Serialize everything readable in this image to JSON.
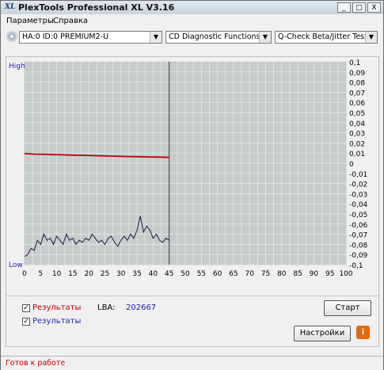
{
  "window": {
    "app_icon_text": "XL",
    "title": "PlexTools Professional XL V3.16",
    "minimize": "_",
    "maximize": "□",
    "close": "X"
  },
  "menu": {
    "items": [
      "Параметры",
      "Справка"
    ]
  },
  "toolbar": {
    "drive": "HA:0 ID:0  PREMIUM2-U",
    "function": "CD Diagnostic Functions",
    "test": "Q-Check Beta/Jitter Test"
  },
  "chart_data": {
    "type": "line",
    "left_axis_labels": {
      "top": "High",
      "bottom": "Low"
    },
    "right_axis": {
      "ticks": [
        "0,1",
        "0,09",
        "0,08",
        "0,07",
        "0,06",
        "0,05",
        "0,04",
        "0,03",
        "0,02",
        "0,01",
        "0",
        "-0,01",
        "-0,02",
        "-0,03",
        "-0,04",
        "-0,05",
        "-0,06",
        "-0,07",
        "-0,08",
        "-0,09",
        "-0,1"
      ],
      "ylim": [
        -0.1,
        0.1
      ]
    },
    "x_ticks": [
      "0",
      "5",
      "10",
      "15",
      "20",
      "25",
      "30",
      "35",
      "40",
      "45",
      "50",
      "55",
      "60",
      "65",
      "70",
      "75",
      "80",
      "85",
      "90",
      "95",
      "100"
    ],
    "xlim": [
      0,
      100
    ],
    "grid": true,
    "progress_x": 45,
    "series": [
      {
        "color": "#c00000",
        "axis": "right",
        "x": [
          0,
          3,
          6,
          9,
          12,
          15,
          18,
          21,
          24,
          27,
          30,
          33,
          36,
          39,
          42,
          45
        ],
        "y": [
          0.0095,
          0.009,
          0.0088,
          0.0085,
          0.0083,
          0.008,
          0.0078,
          0.0075,
          0.0073,
          0.007,
          0.0068,
          0.0066,
          0.0064,
          0.0062,
          0.006,
          0.0058
        ]
      },
      {
        "color": "#1a1a40",
        "axis": "left-relative",
        "x": [
          0,
          1,
          2,
          3,
          4,
          5,
          6,
          7,
          8,
          9,
          10,
          11,
          12,
          13,
          14,
          15,
          16,
          17,
          18,
          19,
          20,
          21,
          22,
          23,
          24,
          25,
          26,
          27,
          28,
          29,
          30,
          31,
          32,
          33,
          34,
          35,
          36,
          37,
          38,
          39,
          40,
          41,
          42,
          43,
          44,
          45
        ],
        "y": [
          0.04,
          0.05,
          0.08,
          0.07,
          0.12,
          0.1,
          0.15,
          0.12,
          0.13,
          0.1,
          0.14,
          0.12,
          0.1,
          0.15,
          0.12,
          0.13,
          0.1,
          0.12,
          0.11,
          0.13,
          0.12,
          0.15,
          0.13,
          0.11,
          0.12,
          0.1,
          0.13,
          0.14,
          0.11,
          0.09,
          0.12,
          0.14,
          0.12,
          0.15,
          0.13,
          0.17,
          0.24,
          0.16,
          0.19,
          0.17,
          0.13,
          0.15,
          0.12,
          0.11,
          0.13,
          0.12
        ]
      }
    ]
  },
  "controls": {
    "results_red_label": "Результаты",
    "results_blue_label": "Результаты",
    "results_red_checked": "✓",
    "results_blue_checked": "✓",
    "lba_label": "LBA:",
    "lba_value": "202667",
    "start_button": "Старт",
    "settings_button": "Настройки",
    "info_button": "i",
    "red_color": "#c00000",
    "blue_color": "#1f1fb0"
  },
  "status": {
    "text": "Готов к работе"
  }
}
